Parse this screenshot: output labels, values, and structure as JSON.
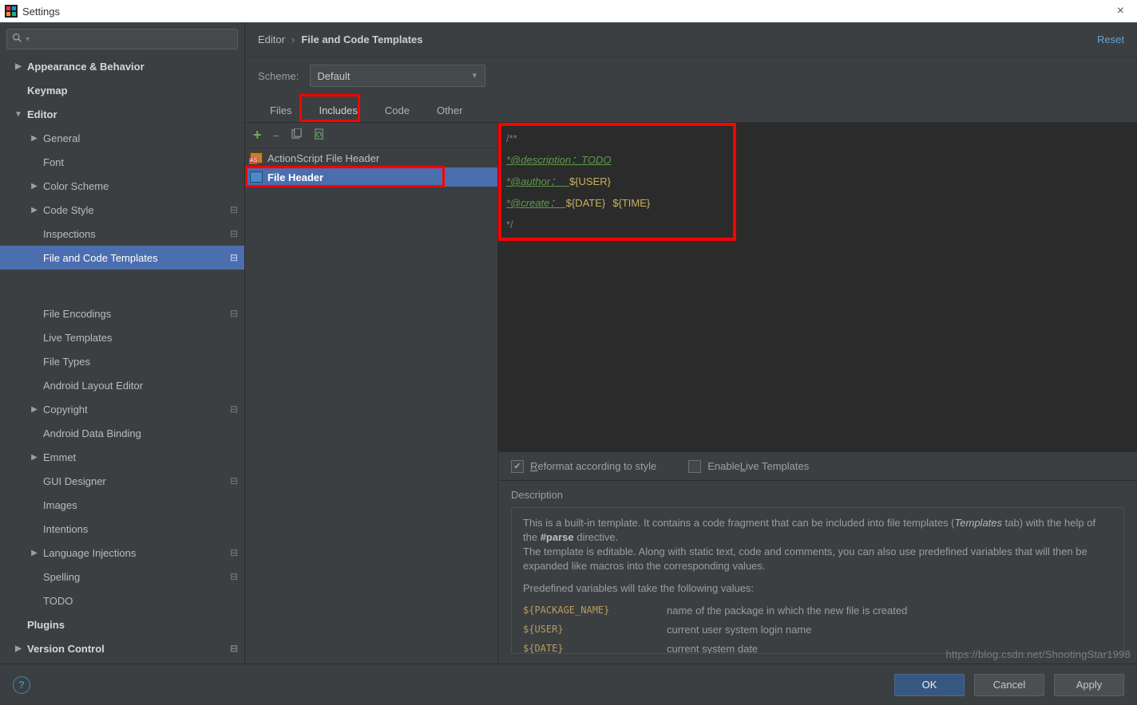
{
  "window": {
    "title": "Settings"
  },
  "search": {
    "icon": "🔍"
  },
  "sidebar": {
    "items": [
      {
        "label": "Appearance & Behavior",
        "level": 0,
        "arrow": "▶"
      },
      {
        "label": "Keymap",
        "level": 0,
        "arrow": ""
      },
      {
        "label": "Editor",
        "level": 0,
        "arrow": "▼"
      },
      {
        "label": "General",
        "level": 1,
        "arrow": "▶"
      },
      {
        "label": "Font",
        "level": 1,
        "arrow": ""
      },
      {
        "label": "Color Scheme",
        "level": 1,
        "arrow": "▶"
      },
      {
        "label": "Code Style",
        "level": 1,
        "arrow": "▶",
        "gear": true
      },
      {
        "label": "Inspections",
        "level": 1,
        "arrow": "",
        "gear": true
      },
      {
        "label": "File and Code Templates",
        "level": 1,
        "arrow": "",
        "gear": true,
        "selected": true,
        "hl": true
      },
      {
        "label": "File Encodings",
        "level": 1,
        "arrow": "",
        "gear": true
      },
      {
        "label": "Live Templates",
        "level": 1,
        "arrow": ""
      },
      {
        "label": "File Types",
        "level": 1,
        "arrow": ""
      },
      {
        "label": "Android Layout Editor",
        "level": 1,
        "arrow": ""
      },
      {
        "label": "Copyright",
        "level": 1,
        "arrow": "▶",
        "gear": true
      },
      {
        "label": "Android Data Binding",
        "level": 1,
        "arrow": ""
      },
      {
        "label": "Emmet",
        "level": 1,
        "arrow": "▶"
      },
      {
        "label": "GUI Designer",
        "level": 1,
        "arrow": "",
        "gear": true
      },
      {
        "label": "Images",
        "level": 1,
        "arrow": ""
      },
      {
        "label": "Intentions",
        "level": 1,
        "arrow": ""
      },
      {
        "label": "Language Injections",
        "level": 1,
        "arrow": "▶",
        "gear": true
      },
      {
        "label": "Spelling",
        "level": 1,
        "arrow": "",
        "gear": true
      },
      {
        "label": "TODO",
        "level": 1,
        "arrow": ""
      },
      {
        "label": "Plugins",
        "level": 0,
        "arrow": ""
      },
      {
        "label": "Version Control",
        "level": 0,
        "arrow": "▶",
        "gear": true
      }
    ]
  },
  "breadcrumb": {
    "root": "Editor",
    "sep": "›",
    "leaf": "File and Code Templates",
    "reset": "Reset"
  },
  "scheme": {
    "label": "Scheme:",
    "value": "Default"
  },
  "tabs": [
    "Files",
    "Includes",
    "Code",
    "Other"
  ],
  "activeTab": 1,
  "toolbar": {
    "add": "+",
    "remove": "−",
    "copy": "⿻",
    "refresh": "↻"
  },
  "templates": [
    {
      "label": "ActionScript File Header",
      "icon": "as"
    },
    {
      "label": "File Header",
      "icon": "f",
      "selected": true,
      "hl": true
    }
  ],
  "code": {
    "l1": "/**",
    "tag1": "*@description：",
    "v1": "TODO",
    "tag2": "*@author：   ",
    "v2": "${USER}",
    "tag3": "*@create：  ",
    "v3a": "${DATE}",
    "v3b": "${TIME}",
    "l5": "*/"
  },
  "options": {
    "reformat_pre": "R",
    "reformat": "eformat according to style",
    "live_pre": "Enable ",
    "live_u": "L",
    "live_post": "ive Templates"
  },
  "description": {
    "heading": "Description",
    "p1a": "This is a built-in template. It contains a code fragment that can be included into file templates (",
    "p1em": "Templates",
    "p1b": " tab) with the help of the ",
    "p1bold": "#parse",
    "p1c": " directive.",
    "p2": "The template is editable. Along with static text, code and comments, you can also use predefined variables that will then be expanded like macros into the corresponding values.",
    "p3": "Predefined variables will take the following values:",
    "vars": [
      {
        "n": "${PACKAGE_NAME}",
        "d": "name of the package in which the new file is created"
      },
      {
        "n": "${USER}",
        "d": "current user system login name"
      },
      {
        "n": "${DATE}",
        "d": "current system date"
      }
    ]
  },
  "footer": {
    "ok": "OK",
    "cancel": "Cancel",
    "apply": "Apply",
    "help": "?"
  },
  "watermark": "https://blog.csdn.net/ShootingStar1998"
}
